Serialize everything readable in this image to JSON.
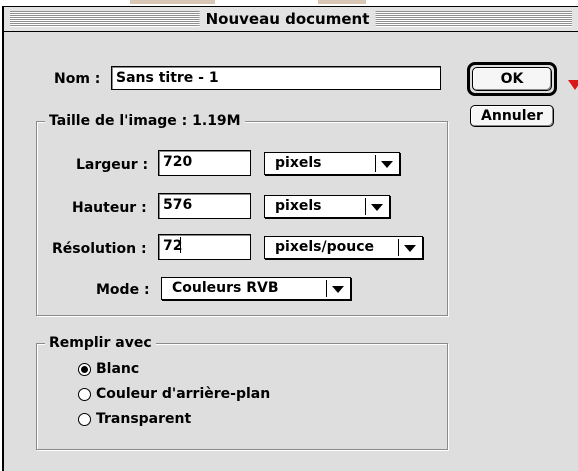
{
  "dialog": {
    "title": "Nouveau document",
    "name_label": "Nom :",
    "name_value": "Sans titre - 1",
    "ok_label": "OK",
    "cancel_label": "Annuler"
  },
  "image_size": {
    "legend": "Taille de l'image : 1.19M",
    "width_label": "Largeur :",
    "width_value": "720",
    "width_unit": "pixels",
    "height_label": "Hauteur :",
    "height_value": "576",
    "height_unit": "pixels",
    "resolution_label": "Résolution :",
    "resolution_value": "72",
    "resolution_unit": "pixels/pouce",
    "mode_label": "Mode :",
    "mode_value": "Couleurs RVB"
  },
  "fill": {
    "legend": "Remplir avec",
    "options": [
      "Blanc",
      "Couleur d'arrière-plan",
      "Transparent"
    ],
    "selected_index": 0
  },
  "colors": {
    "dialog_bg": "#dedede",
    "accent_arrow": "#d81818"
  },
  "icons": [
    "chevron-down-icon",
    "red-pointer-icon",
    "radio-selected-icon",
    "radio-empty-icon"
  ]
}
